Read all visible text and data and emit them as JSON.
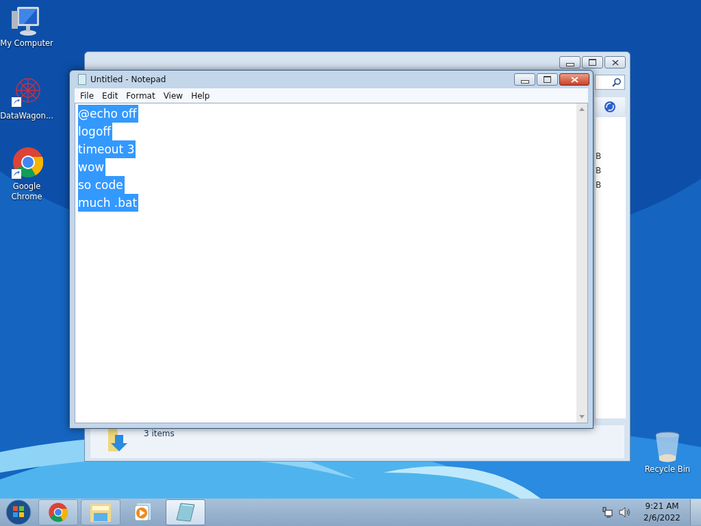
{
  "desktop_icons": [
    {
      "label": "My Computer",
      "kind": "computer"
    },
    {
      "label": "DataWagon...",
      "kind": "shortcut"
    },
    {
      "label": "Google Chrome",
      "kind": "chrome"
    }
  ],
  "recycle_bin": {
    "label": "Recycle Bin"
  },
  "background_window": {
    "column_3": [
      "B",
      "B",
      "B"
    ],
    "status": "3 items"
  },
  "notepad": {
    "title": "Untitled - Notepad",
    "menu": [
      "File",
      "Edit",
      "Format",
      "View",
      "Help"
    ],
    "lines": [
      {
        "text": "@echo off",
        "selected": true
      },
      {
        "text": "logoff",
        "selected": true
      },
      {
        "text": "timeout 3",
        "selected": true
      },
      {
        "text": "wow",
        "selected": true
      },
      {
        "text": "so code",
        "selected": true
      },
      {
        "text": "much .bat",
        "selected": true
      }
    ]
  },
  "taskbar": {
    "buttons": [
      {
        "kind": "chrome",
        "selected": false
      },
      {
        "kind": "explorer",
        "selected": false
      },
      {
        "kind": "media",
        "selected": false
      },
      {
        "kind": "notepad",
        "selected": true
      }
    ],
    "time": "9:21 AM",
    "date": "2/6/2022"
  }
}
